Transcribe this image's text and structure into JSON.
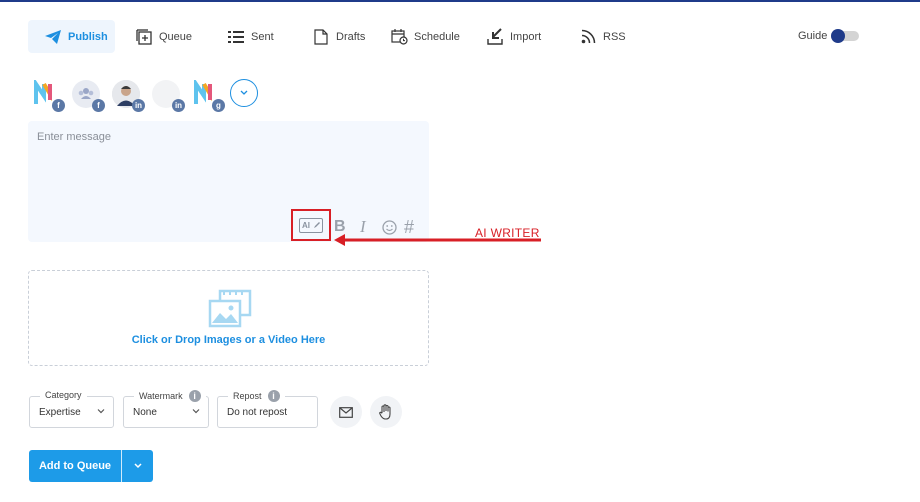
{
  "nav": {
    "publish": "Publish",
    "queue": "Queue",
    "sent": "Sent",
    "drafts": "Drafts",
    "schedule": "Schedule",
    "import": "Import",
    "rss": "RSS",
    "guide": "Guide"
  },
  "profiles": [
    {
      "network": "facebook",
      "badge": "f"
    },
    {
      "network": "facebook",
      "badge": "f"
    },
    {
      "network": "linkedin",
      "badge": "in"
    },
    {
      "network": "linkedin",
      "badge": "in"
    },
    {
      "network": "google-business",
      "badge": "g"
    }
  ],
  "composer": {
    "placeholder": "Enter message",
    "ai_label": "AI",
    "bold": "B",
    "italic": "I",
    "hashtag": "#"
  },
  "annotation": "AI WRITER",
  "media": {
    "label": "Click or Drop Images or a Video Here"
  },
  "category": {
    "label": "Category",
    "value": "Expertise"
  },
  "watermark": {
    "label": "Watermark",
    "value": "None"
  },
  "repost": {
    "label": "Repost",
    "value": "Do not repost"
  },
  "actions": {
    "add_to_queue": "Add to Queue"
  },
  "colors": {
    "accent": "#1d8fe0",
    "annotation": "#d81f26",
    "primary_button": "#1d9be8"
  }
}
